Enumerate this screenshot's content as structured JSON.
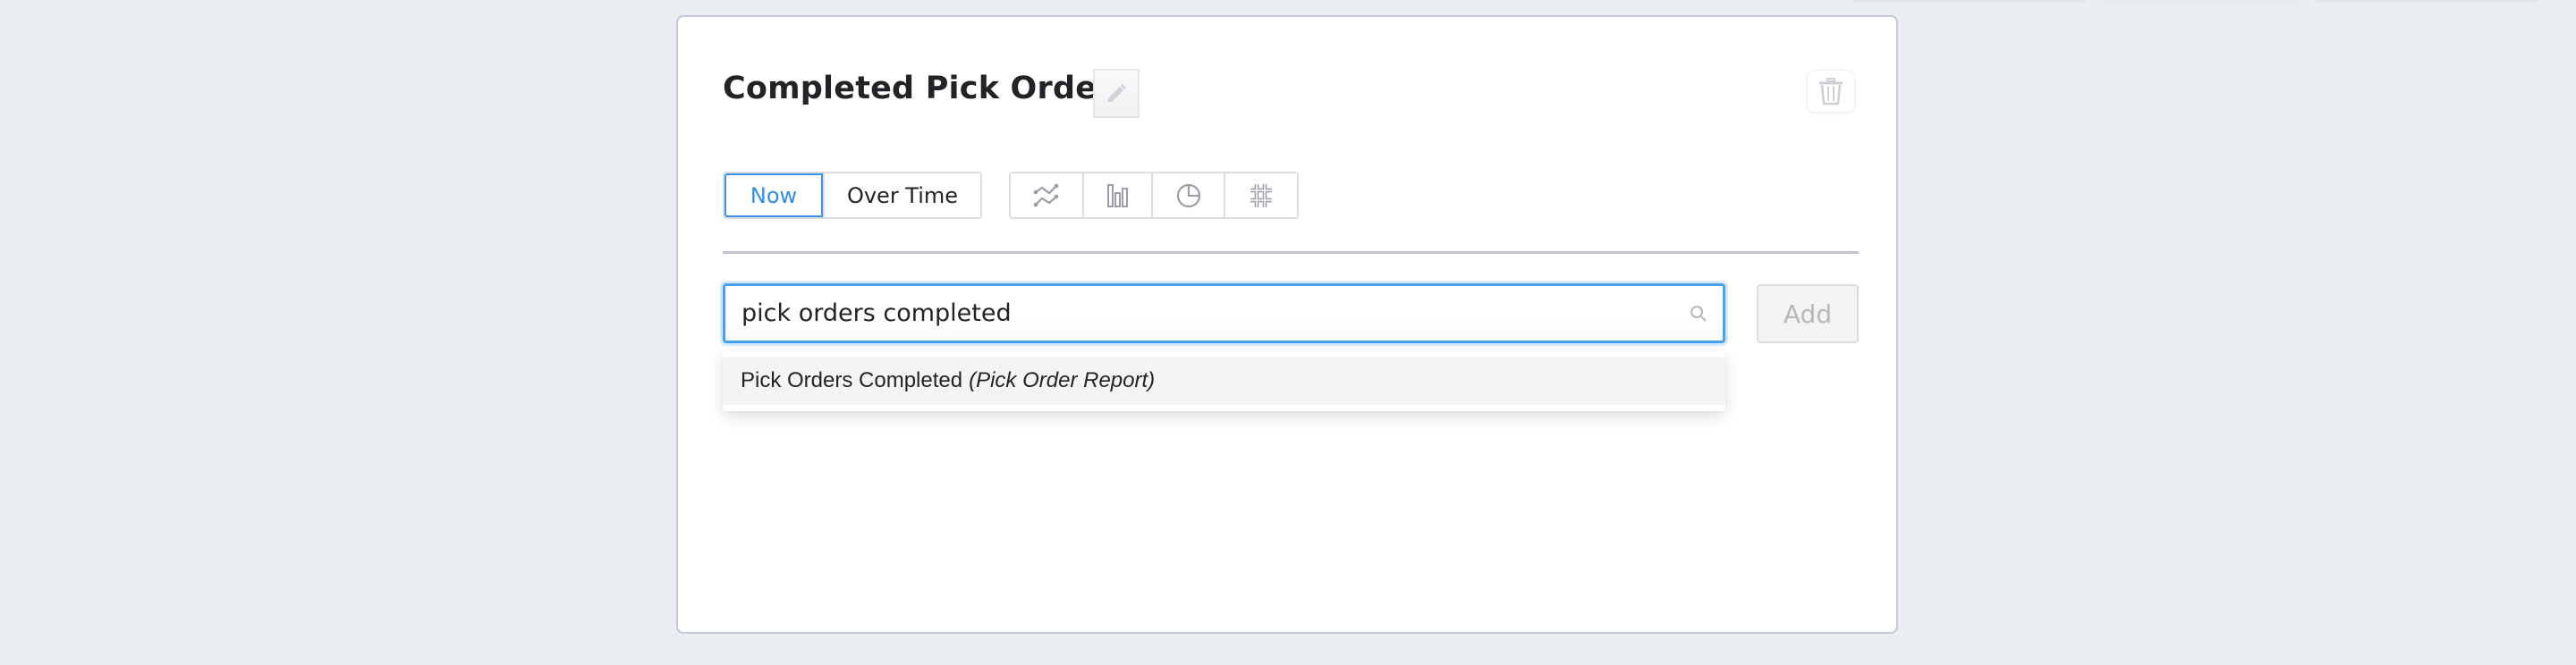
{
  "widget": {
    "title": "Completed Pick Orders",
    "edit_icon": "pencil-icon",
    "delete_icon": "trash-icon"
  },
  "time_toggle": {
    "options": [
      {
        "label": "Now",
        "active": true
      },
      {
        "label": "Over Time",
        "active": false
      }
    ]
  },
  "chart_types": [
    {
      "name": "line-chart",
      "icon": "line-chart-icon"
    },
    {
      "name": "bar-chart",
      "icon": "bar-chart-icon"
    },
    {
      "name": "pie-chart",
      "icon": "pie-chart-icon"
    },
    {
      "name": "number",
      "icon": "hash-icon"
    }
  ],
  "search": {
    "value": "pick orders completed",
    "icon": "search-icon"
  },
  "add_button": {
    "label": "Add",
    "disabled": true
  },
  "suggestions": [
    {
      "name": "Pick Orders Completed",
      "source": "(Pick Order Report)"
    }
  ],
  "colors": {
    "accent": "#3f93e4",
    "background": "#eaedf2",
    "card_border": "#c4c6d9"
  }
}
